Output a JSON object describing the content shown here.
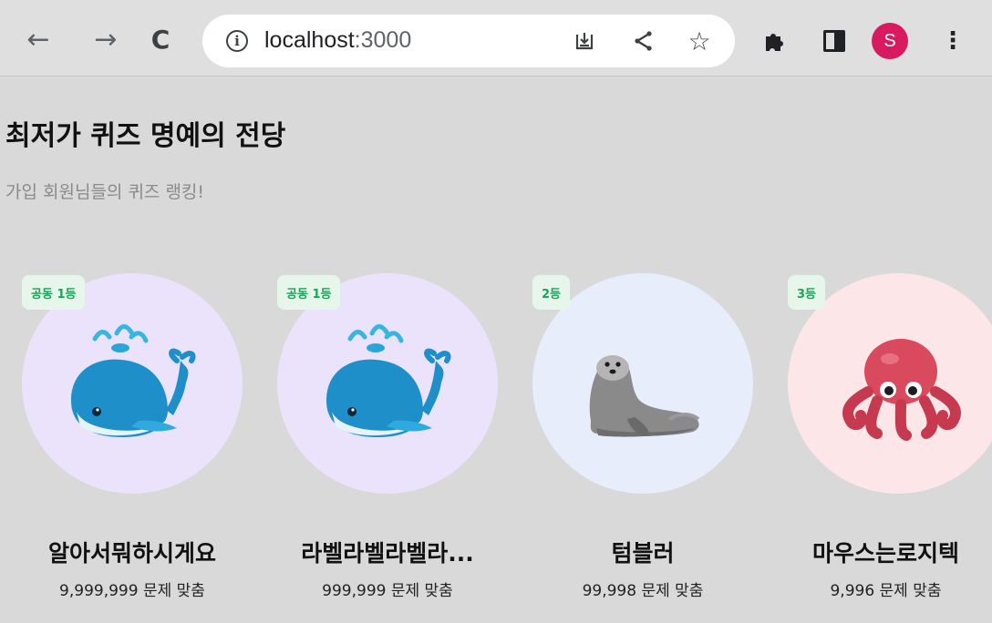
{
  "browser": {
    "url_host": "localhost",
    "url_port": ":3000",
    "profile_initial": "S"
  },
  "page": {
    "title": "최저가 퀴즈 명예의 전당",
    "subtitle": "가입 회원님들의 퀴즈 랭킹!"
  },
  "ranking": [
    {
      "badge": "공동 1등",
      "name": "알아서뭐하시게요",
      "score": "9,999,999 문제 맞춤",
      "icon": "whale-icon",
      "bg_color": "#ebe3fb"
    },
    {
      "badge": "공동 1등",
      "name": "라벨라벨라벨라...",
      "score": "999,999 문제 맞춤",
      "icon": "whale-icon",
      "bg_color": "#ebe3fb"
    },
    {
      "badge": "2등",
      "name": "텀블러",
      "score": "99,998 문제 맞춤",
      "icon": "seal-icon",
      "bg_color": "#e8edfb"
    },
    {
      "badge": "3등",
      "name": "마우스는로지텍",
      "score": "9,996 문제 맞춤",
      "icon": "octopus-icon",
      "bg_color": "#fde6e8"
    }
  ],
  "colors": {
    "badge_bg": "#e6f6ea",
    "badge_text": "#1aa35a",
    "avatar": "#d81b60",
    "page_bg": "#d9d9d9"
  }
}
